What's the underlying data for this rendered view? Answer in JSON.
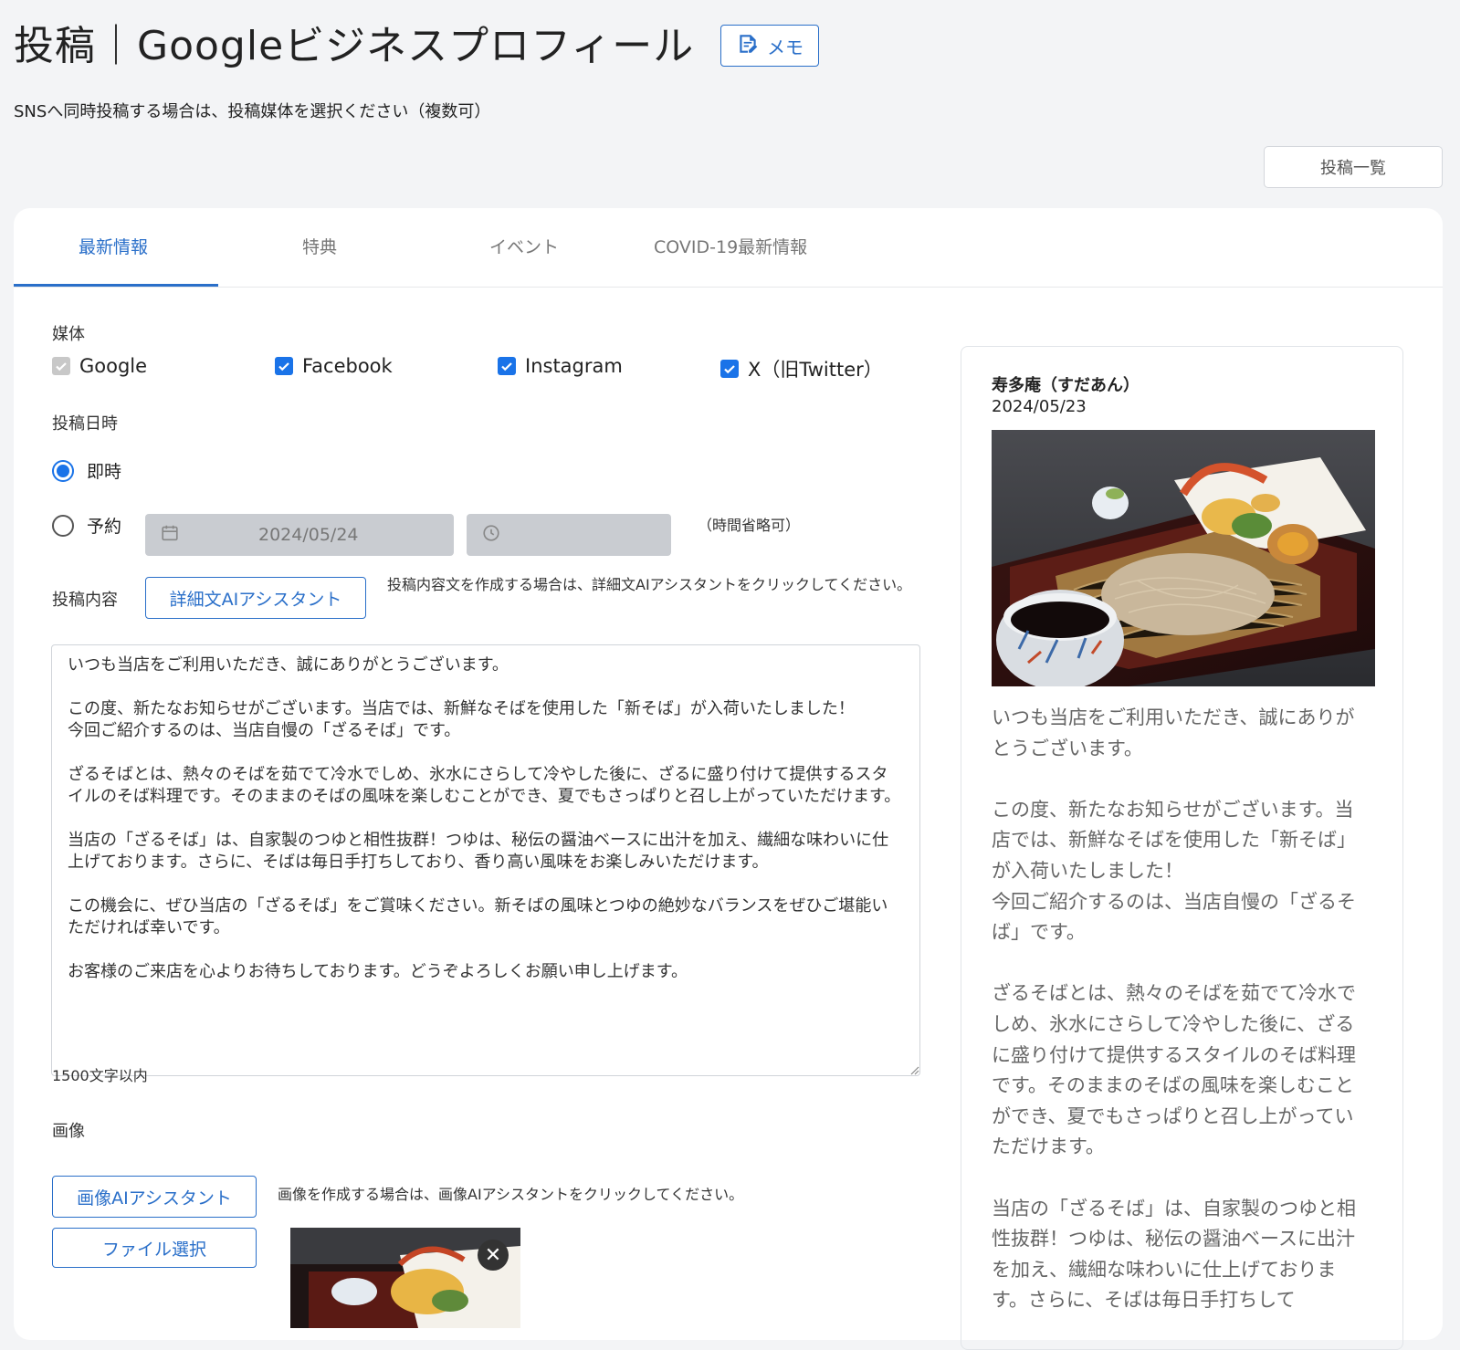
{
  "header": {
    "title": "投稿｜Googleビジネスプロフィール",
    "memo_label": "メモ",
    "subtitle": "SNSへ同時投稿する場合は、投稿媒体を選択ください（複数可）",
    "list_button": "投稿一覧"
  },
  "tabs": [
    {
      "label": "最新情報",
      "active": true
    },
    {
      "label": "特典",
      "active": false
    },
    {
      "label": "イベント",
      "active": false
    },
    {
      "label": "COVID-19最新情報",
      "active": false
    }
  ],
  "media": {
    "label": "媒体",
    "options": [
      {
        "label": "Google",
        "checked": true,
        "disabled": true
      },
      {
        "label": "Facebook",
        "checked": true,
        "disabled": false
      },
      {
        "label": "Instagram",
        "checked": true,
        "disabled": false
      },
      {
        "label": "X（旧Twitter）",
        "checked": true,
        "disabled": false
      }
    ]
  },
  "schedule": {
    "label": "投稿日時",
    "immediate": "即時",
    "reserve": "予約",
    "selected": "即時",
    "date_value": "2024/05/24",
    "time_value": "",
    "time_note": "（時間省略可）"
  },
  "content": {
    "label": "投稿内容",
    "ai_button": "詳細文AIアシスタント",
    "hint": "投稿内容文を作成する場合は、詳細文AIアシスタントをクリックしてください。",
    "text": "いつも当店をご利用いただき、誠にありがとうございます。\n\nこの度、新たなお知らせがございます。当店では、新鮮なそばを使用した「新そば」が入荷いたしました！\n今回ご紹介するのは、当店自慢の「ざるそば」です。\n\nざるそばとは、熱々のそばを茹でて冷水でしめ、氷水にさらして冷やした後に、ざるに盛り付けて提供するスタイルのそば料理です。そのままのそばの風味を楽しむことができ、夏でもさっぱりと召し上がっていただけます。\n\n当店の「ざるそば」は、自家製のつゆと相性抜群！つゆは、秘伝の醤油ベースに出汁を加え、繊細な味わいに仕上げております。さらに、そばは毎日手打ちしており、香り高い風味をお楽しみいただけます。\n\nこの機会に、ぜひ当店の「ざるそば」をご賞味ください。新そばの風味とつゆの絶妙なバランスをぜひご堪能いただければ幸いです。\n\nお客様のご来店を心よりお待ちしております。どうぞよろしくお願い申し上げます。",
    "limit": "1500文字以内"
  },
  "image": {
    "label": "画像",
    "ai_button": "画像AIアシスタント",
    "hint": "画像を作成する場合は、画像AIアシスタントをクリックしてください。",
    "file_button": "ファイル選択"
  },
  "preview": {
    "store_name": "寿多庵（すだあん）",
    "date": "2024/05/23",
    "text": "いつも当店をご利用いただき、誠にありがとうございます。\n\nこの度、新たなお知らせがございます。当店では、新鮮なそばを使用した「新そば」が入荷いたしました！\n今回ご紹介するのは、当店自慢の「ざるそば」です。\n\nざるそばとは、熱々のそばを茹でて冷水でしめ、氷水にさらして冷やした後に、ざるに盛り付けて提供するスタイルのそば料理です。そのままのそばの風味を楽しむことができ、夏でもさっぱりと召し上がっていただけます。\n\n当店の「ざるそば」は、自家製のつゆと相性抜群！つゆは、秘伝の醤油ベースに出汁を加え、繊細な味わいに仕上げております。さらに、そばは毎日手打ちして"
  },
  "colors": {
    "accent": "#2a6fc9",
    "checkbox": "#1a73e8",
    "background": "#f3f4f6"
  }
}
